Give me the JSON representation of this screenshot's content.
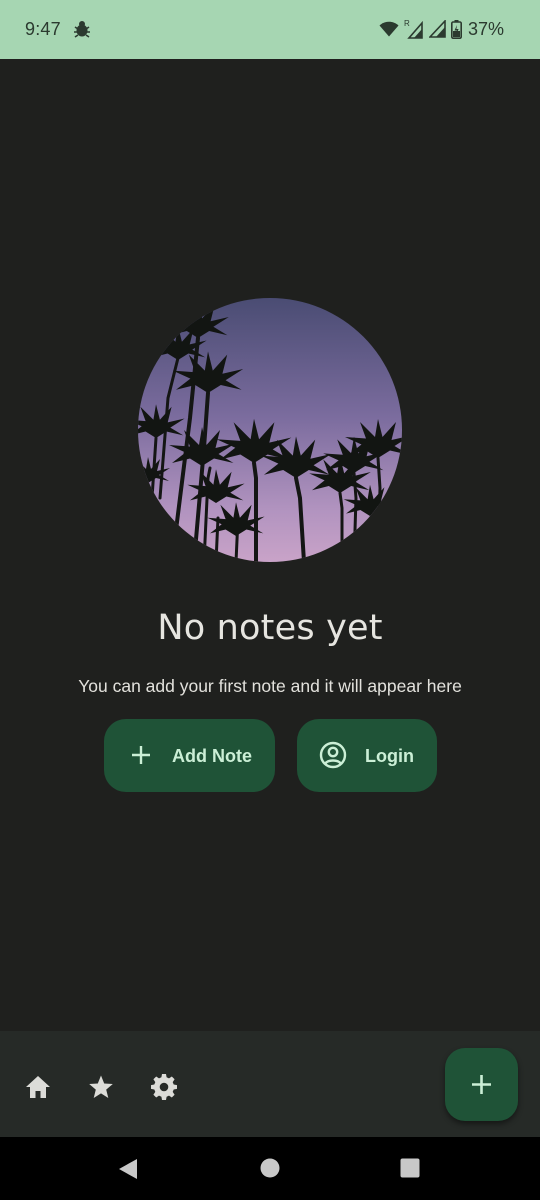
{
  "status_bar": {
    "time": "9:47",
    "battery_percent": "37%",
    "icons": [
      "notification-bug-icon",
      "wifi-icon",
      "roaming-signal-icon",
      "signal-icon",
      "battery-charging-icon"
    ]
  },
  "empty_state": {
    "image": "palm-trees-sunset-image",
    "title": "No notes yet",
    "subtitle": "You can add your first note and it will appear here"
  },
  "actions": {
    "add_note": {
      "label": "Add Note",
      "icon": "plus-icon"
    },
    "login": {
      "label": "Login",
      "icon": "account-circle-icon"
    }
  },
  "bottom_bar": {
    "items": [
      {
        "name": "home",
        "icon": "home-icon"
      },
      {
        "name": "favorites",
        "icon": "star-icon"
      },
      {
        "name": "settings",
        "icon": "gear-icon"
      }
    ],
    "fab_icon": "plus-icon"
  },
  "system_nav": [
    "back",
    "home",
    "recents"
  ],
  "colors": {
    "status_bar": "#a6d6b2",
    "background": "#1f201e",
    "button": "#1f5337",
    "button_text": "#cbefd6",
    "bottom_bar": "#262a27"
  }
}
